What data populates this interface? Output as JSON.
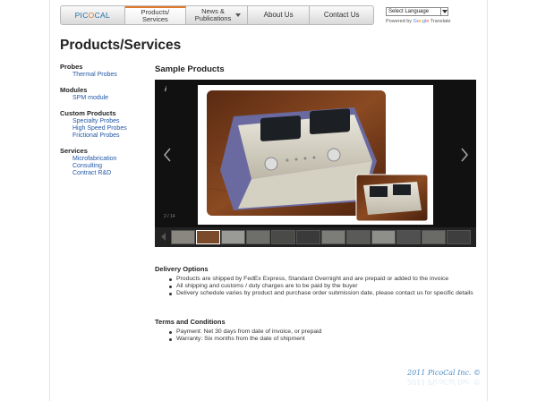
{
  "nav": {
    "logo": "PICOCAL",
    "items": [
      {
        "label_line1": "Products/",
        "label_line2": "Services"
      },
      {
        "label_line1": "News &",
        "label_line2": "Publications"
      },
      {
        "label_line1": "About Us",
        "label_line2": ""
      },
      {
        "label_line1": "Contact Us",
        "label_line2": ""
      }
    ],
    "active_color": "#e07a2a"
  },
  "translate": {
    "select_value": "Select Language",
    "powered_prefix": "Powered by",
    "powered_suffix": "Translate"
  },
  "page_title": "Products/Services",
  "sidebar": [
    {
      "heading": "Probes",
      "links": [
        "Thermal Probes"
      ]
    },
    {
      "heading": "Modules",
      "links": [
        "SPM module"
      ]
    },
    {
      "heading": "Custom Products",
      "links": [
        "Specialty Probes",
        "High Speed Probes",
        "Frictional Probes"
      ]
    },
    {
      "heading": "Services",
      "links": [
        "Microfabrication",
        "Consulting",
        "Contract R&D"
      ]
    }
  ],
  "gallery": {
    "title": "Sample Products",
    "info_icon": "i",
    "counter": "2 / 14",
    "thumb_count": 12,
    "active_thumb": 1
  },
  "delivery": {
    "heading": "Delivery Options",
    "items": [
      "Products are shipped by FedEx Express, Standard Overnight and are prepaid or added to the invoice",
      "All shipping and customs / duty charges are to be paid by the buyer",
      "Delivery schedule varies by product and purchase order submission date, please contact us for specific details"
    ]
  },
  "terms": {
    "heading": "Terms and Conditions",
    "items": [
      "Payment: Net 30 days from date of invoice, or prepaid",
      "Warranty: Six months from the date of shipment"
    ]
  },
  "footer": {
    "copyright": "2011 PicoCal Inc. ©"
  }
}
